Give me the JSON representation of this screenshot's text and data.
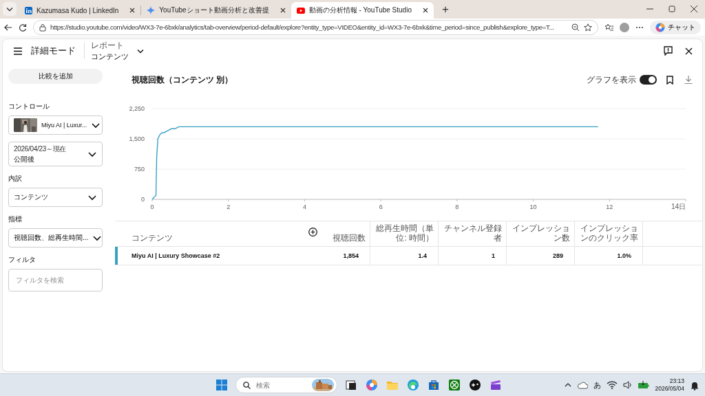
{
  "browser": {
    "tabs": [
      {
        "kind": "linkedin",
        "title": "Kazumasa Kudo | LinkedIn",
        "selected": false
      },
      {
        "kind": "gemini",
        "title": "YouTubeショート動画分析と改善提",
        "selected": false
      },
      {
        "kind": "youtube",
        "title": "動画の分析情報 - YouTube Studio",
        "selected": true
      }
    ],
    "new_tab": "+",
    "url": "https://studio.youtube.com/video/WX3-7e-6bxk/analytics/tab-overview/period-default/explore?entity_type=VIDEO&entity_id=WX3-7e-6bxk&time_period=since_publish&explore_type=T...",
    "chat_button": "チャット"
  },
  "header": {
    "title": "詳細モード",
    "report_label": "レポート",
    "report_value": "コンテンツ"
  },
  "sidebar": {
    "compare_button": "比較を追加",
    "sections": [
      {
        "kind": "video",
        "label": "コントロール",
        "value": "Miyu AI | Luxur..."
      },
      {
        "kind": "date",
        "sub": "2026/04/23～現在",
        "value": "公開後"
      },
      {
        "kind": "select",
        "label": "内訳",
        "value": "コンテンツ"
      },
      {
        "kind": "select",
        "label": "指標",
        "value": "視聴回数、総再生時間..."
      },
      {
        "kind": "search",
        "label": "フィルタ",
        "placeholder": "フィルタを検索"
      }
    ]
  },
  "main": {
    "show_chart": {
      "label": "グラフを表示",
      "on": true
    },
    "chart_data": {
      "type": "line",
      "title": "視聴回数（コンテンツ 別）",
      "x": [
        0,
        0.05,
        0.1,
        0.12,
        0.15,
        0.2,
        0.25,
        0.3,
        0.4,
        0.5,
        0.6,
        0.7,
        1.5,
        1.6,
        2,
        4,
        6,
        8,
        10,
        11.7
      ],
      "series": [
        {
          "color": "#3aa0c2",
          "values": [
            0,
            50,
            100,
            1050,
            1500,
            1600,
            1650,
            1650,
            1700,
            1750,
            1750,
            1800,
            1800,
            1800,
            1800,
            1800,
            1800,
            1800,
            1800,
            1800
          ]
        }
      ],
      "xlim": [
        0,
        14
      ],
      "ylim": [
        0,
        2250
      ],
      "xticks": [
        0,
        2,
        4,
        6,
        8,
        10,
        12,
        {
          "value": 14,
          "label": "14日"
        }
      ],
      "yticks": [
        0,
        {
          "value": 750,
          "label": "750"
        },
        {
          "value": 1500,
          "label": "1,500"
        },
        {
          "value": 2250,
          "label": "2,250"
        }
      ]
    },
    "table": {
      "columns": [
        "コンテンツ",
        "視聴回数",
        "総再生時間（単位: 時間）",
        "チャンネル登録者",
        "インプレッション数",
        "インプレッションのクリック率"
      ],
      "rows": [
        {
          "color": "#3aa0c2",
          "cells": [
            "Miyu AI | Luxury Showcase #2",
            "1,854",
            "1.4",
            "1",
            "289",
            "1.0%"
          ]
        }
      ]
    }
  },
  "taskbar": {
    "search_placeholder": "検索",
    "ime": "あ",
    "time": "23:13",
    "date": "2026/05/04"
  }
}
